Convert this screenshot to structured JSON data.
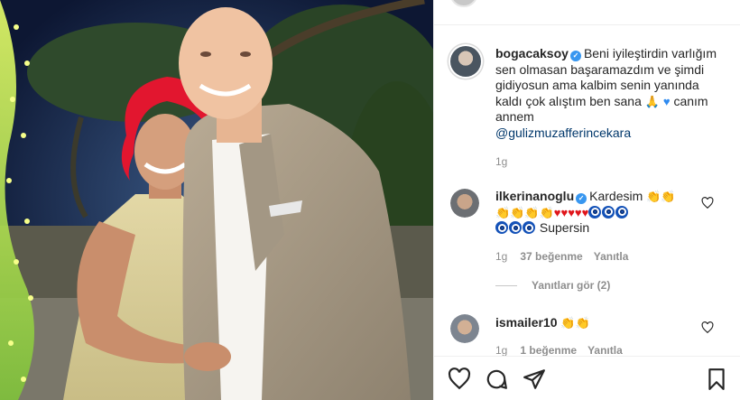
{
  "post": {
    "author": "bogacaksoy",
    "verified": true,
    "caption_text": "Beni iyileştirdin varlığım sen olmasan başaramazdım ve şimdi gidiyosun ama kalbim senin yanında kaldı çok alıştım ben sana",
    "caption_after_emoji": "canım annem",
    "mention": "@gulizmuzafferincekara",
    "time": "1g"
  },
  "comments": [
    {
      "username": "ilkerinanoglu",
      "verified": true,
      "text_start": "Kardesim",
      "text_end": "Supersin",
      "time": "1g",
      "likes": "37 beğenme",
      "reply_label": "Yanıtla"
    },
    {
      "username": "ismailer10",
      "verified": false,
      "time": "1g",
      "likes": "1 beğenme",
      "reply_label": "Yanıtla"
    }
  ],
  "replies_toggle": "Yanıtları gör (2)",
  "icons": {
    "like": "heart-outline-icon",
    "comment": "speech-bubble-icon",
    "share": "paper-plane-icon",
    "save": "bookmark-icon",
    "comment_like": "small-heart-icon",
    "verified": "verified-badge-icon"
  },
  "colors": {
    "text": "#262626",
    "secondary": "#8e8e8e",
    "mention": "#00376b",
    "verified": "#3897f0"
  }
}
